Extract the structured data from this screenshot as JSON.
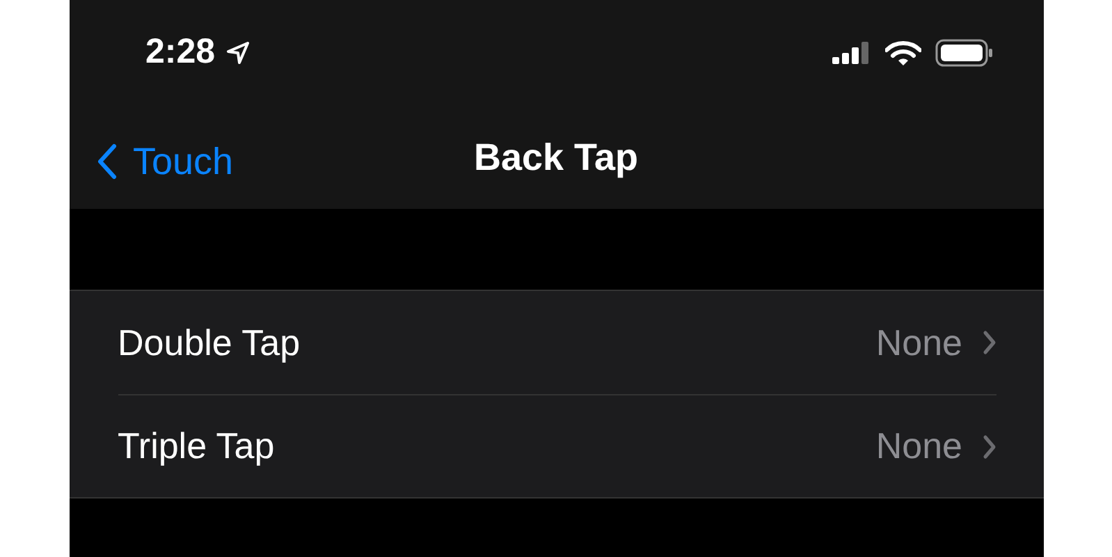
{
  "status_bar": {
    "time": "2:28"
  },
  "nav_bar": {
    "back_label": "Touch",
    "title": "Back Tap"
  },
  "rows": [
    {
      "label": "Double Tap",
      "value": "None"
    },
    {
      "label": "Triple Tap",
      "value": "None"
    }
  ]
}
